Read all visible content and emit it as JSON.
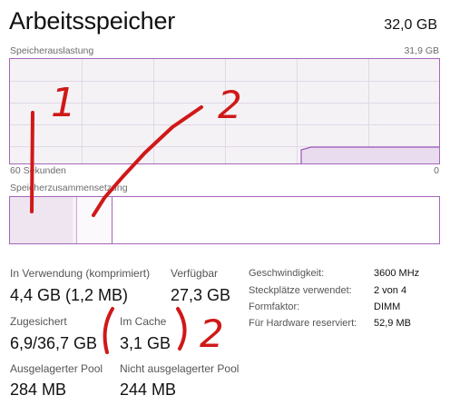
{
  "header": {
    "title": "Arbeitsspeicher",
    "total": "32,0 GB"
  },
  "usage_chart": {
    "label": "Speicherauslastung",
    "max_label": "31,9 GB",
    "time_label": "60 Sekunden",
    "zero_label": "0",
    "line_color": "#9a58b5"
  },
  "composition": {
    "label": "Speicherzusammensetzung",
    "accent": "#a766b9"
  },
  "stats": {
    "in_use_label": "In Verwendung (komprimiert)",
    "in_use_value": "4,4 GB (1,2 MB)",
    "available_label": "Verfügbar",
    "available_value": "27,3 GB",
    "committed_label": "Zugesichert",
    "committed_value": "6,9/36,7 GB",
    "cache_label": "Im Cache",
    "cache_value": "3,1 GB",
    "paged_label": "Ausgelagerter Pool",
    "paged_value": "284 MB",
    "nonpaged_label": "Nicht ausgelagerter Pool",
    "nonpaged_value": "244 MB"
  },
  "specs": {
    "speed_label": "Geschwindigkeit:",
    "speed_value": "3600 MHz",
    "slots_label": "Steckplätze verwendet:",
    "slots_value": "2 von 4",
    "form_label": "Formfaktor:",
    "form_value": "DIMM",
    "reserved_label": "Für Hardware reserviert:",
    "reserved_value": "52,9 MB"
  },
  "annotations": {
    "mark_1": "1",
    "mark_2_top": "2",
    "mark_2_bottom": "2",
    "ink_color": "#d01818"
  }
}
